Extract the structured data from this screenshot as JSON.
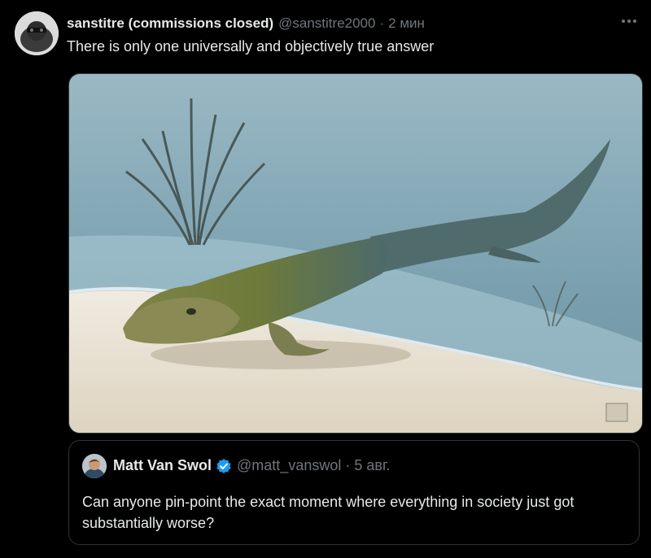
{
  "tweet": {
    "author_name": "sanstitre (commissions closed)",
    "author_handle": "@sanstitre2000",
    "separator": "·",
    "time": "2 мин",
    "text": "There is only one universally and objectively true answer",
    "more_icon": "more-horizontal-icon"
  },
  "media": {
    "image_subject": "tiktaalik-illustration",
    "colors": {
      "water": "#8fb2c0",
      "sand": "#e9e2d3",
      "creature": "#6f7a3c"
    }
  },
  "quoted_tweet": {
    "author_name": "Matt Van Swol",
    "verified": true,
    "author_handle": "@matt_vanswol",
    "separator": "·",
    "date": "5 авг.",
    "text": "Can anyone pin-point the exact moment where everything in society just got substantially worse?"
  },
  "colors": {
    "background": "#000000",
    "primary_text": "#e7e9ea",
    "secondary_text": "#71767b",
    "border": "#2f3336",
    "verified_badge": "#1d9bf0"
  }
}
